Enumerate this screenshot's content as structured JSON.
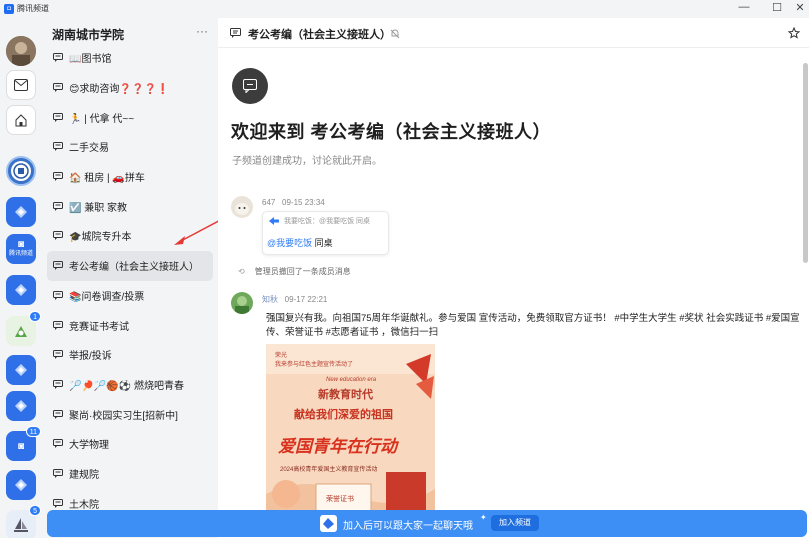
{
  "app": {
    "name": "腾讯频道"
  },
  "window": {
    "minimize": "—",
    "maximize": "☐",
    "close": "✕"
  },
  "rail": {
    "badges": [
      "1",
      "11",
      "5"
    ],
    "tencent_label": "腾讯频道"
  },
  "guild": {
    "name": "湖南城市学院",
    "more": "···"
  },
  "channels": [
    {
      "label": "📖图书馆"
    },
    {
      "label": "😊求助咨询❓❓❓❗"
    },
    {
      "label": "🏃 | 代拿 代~~"
    },
    {
      "label": "二手交易"
    },
    {
      "label": "🏠 租房 | 🚗拼车"
    },
    {
      "label": "☑️ 兼职 家教"
    },
    {
      "label": "🎓城院专升本"
    },
    {
      "label": "考公考编（社会主义接班人）"
    },
    {
      "label": "📚问卷调查/投票"
    },
    {
      "label": "竞赛证书考试"
    },
    {
      "label": "举报/投诉"
    },
    {
      "label": "🏸🏓🏸🏀⚽ 燃烧吧青春"
    },
    {
      "label": "聚尚·校园实习生[招新中]"
    },
    {
      "label": "大学物理"
    },
    {
      "label": "建规院"
    },
    {
      "label": "土木院"
    }
  ],
  "header": {
    "title": "考公考编（社会主义接班人）"
  },
  "welcome": {
    "title": "欢迎来到 考公考编（社会主义接班人）",
    "subtitle": "子频道创建成功，讨论就此开启。"
  },
  "messages": [
    {
      "author": "647",
      "time": "09-15 23:34",
      "quote": "我要吃饭：@我要吃饭 同桌",
      "mention": "@我要吃饭",
      "text": "同桌"
    },
    {
      "author": "知秋",
      "time": "09-17 22:21",
      "text": "强国复兴有我。向祖国75周年华诞献礼。参与爱国 宣传活动，免费领取官方证书！ #中学生大学生 #奖状 社会实践证书 #爱国宣传、荣誉证书 #志愿者证书   ，微信扫一扫"
    }
  ],
  "system_notice": "管理员撤回了一条成员消息",
  "poster": {
    "org_line": "荣光",
    "org_sub": "我来参与红色主题宣传活动了",
    "en": "New education era",
    "era": "新教育时代",
    "headline": "献给我们深爱的祖国",
    "slogan": "爱国青年在行动",
    "activity": "2024高校青年爱国主义教育宣传活动",
    "cert": "荣誉证书"
  },
  "bottom_bar": {
    "text": "加入后可以跟大家一起聊天哦",
    "join": "加入频道"
  },
  "colors": {
    "accent": "#3d8ef5",
    "rail_blue": "#2f6fe8",
    "sidebar_bg": "#f3f4f6",
    "link": "#2f7cf6",
    "red_arrow": "#e53935"
  }
}
